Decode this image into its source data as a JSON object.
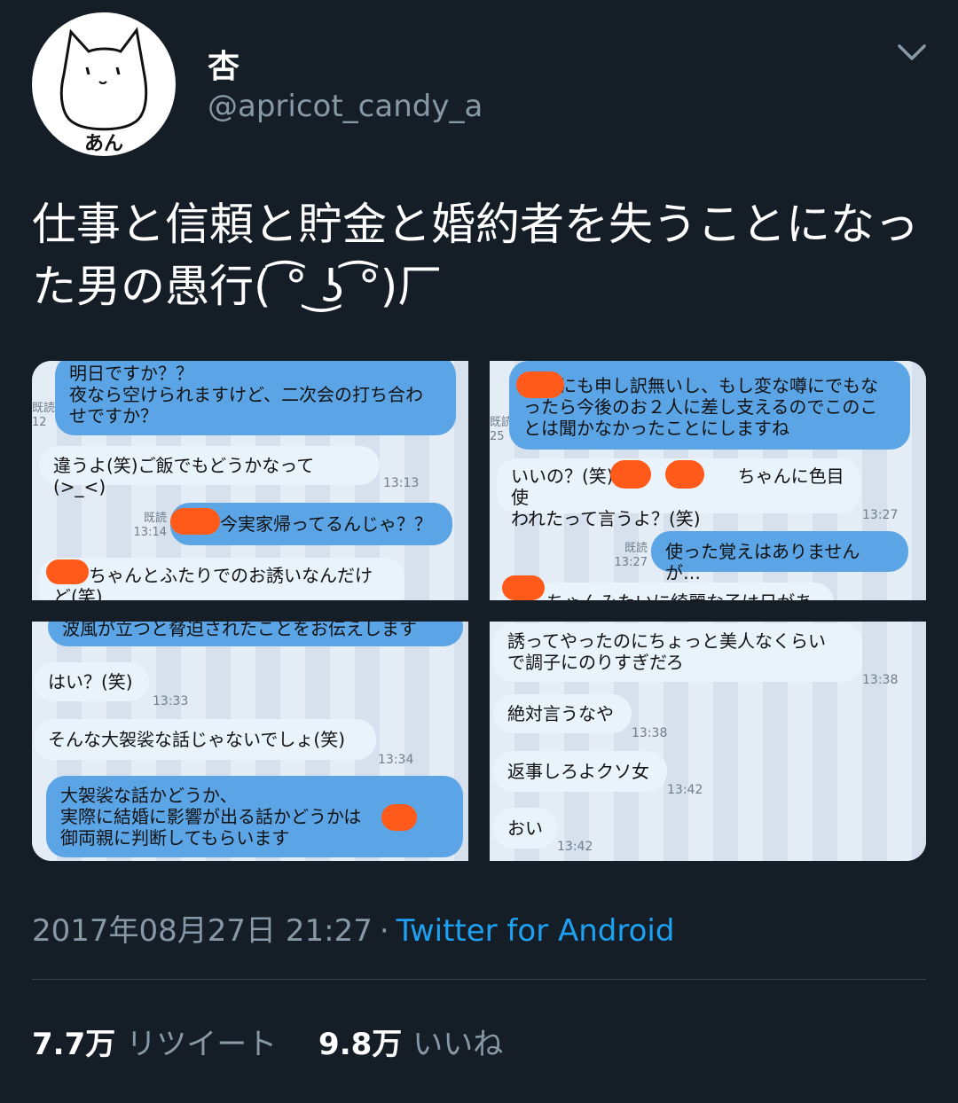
{
  "user": {
    "display_name": "杏",
    "handle": "@apricot_candy_a",
    "avatar_text": "あん"
  },
  "tweet": {
    "text": "仕事と信頼と貯金と婚約者を失うことになった男の愚行( ͡° ͜ʖ ͡°)厂",
    "timestamp": "2017年08月27日 21:27",
    "separator": "·",
    "source": "Twitter for Android"
  },
  "screenshots": {
    "s1": {
      "side": "既読\n12",
      "b1": "明日ですか？？\n夜なら空けられますけど、二次会の打ち合わ\nせですか？",
      "b2": "違うよ(笑)ご飯でもどうかなって(>_<)",
      "t2": "13:13",
      "read3": "既読\n13:14",
      "b3": "　　今実家帰ってるんじゃ？？",
      "b4": "　　ちゃんとふたりでのお誘いなんだけ\nど(笑)"
    },
    "s2": {
      "side": "既読\n25",
      "b1": "　　にも申し訳無いし、もし変な噂にでもな\nったら今後のお２人に差し支えるのでこのこ\nとは聞かなかったことにしますね",
      "b2": "いいの？(笑)　　　に　　　ちゃんに色目使\nわれたって言うよ？(笑)",
      "t2": "13:27",
      "read3": "既読\n13:27",
      "b3": "使った覚えはありませんが…",
      "b4": "　　ちゃんみたいに綺麗な子は日があっ"
    },
    "s3": {
      "b1": "波風が立つと脅迫されたことをお伝えします",
      "b2": "はい？(笑)",
      "t2": "13:33",
      "b3": "そんな大袈裟な話じゃないでしょ(笑)",
      "t3": "13:34",
      "b4": "大袈裟な話かどうか、\n実際に結婚に影響が出る話かどうかは　　と\n御両親に判断してもらいます"
    },
    "s4": {
      "b1": "誘ってやったのにちょっと美人なくらい\nで調子にのりすぎだろ",
      "t1": "13:38",
      "b2": "絶対言うなや",
      "t2": "13:38",
      "b3": "返事しろよクソ女",
      "t3": "13:42",
      "b4": "おい",
      "t4": "13:42"
    }
  },
  "stats": {
    "retweets_count": "7.7万",
    "retweets_label": "リツイート",
    "likes_count": "9.8万",
    "likes_label": "いいね"
  },
  "colors": {
    "background": "#151d27",
    "link": "#1da1f2",
    "muted": "#8899a6",
    "bubble_sent": "#5ba5e6",
    "bubble_received": "#e9f3fc",
    "redaction": "#ff5a1a"
  }
}
